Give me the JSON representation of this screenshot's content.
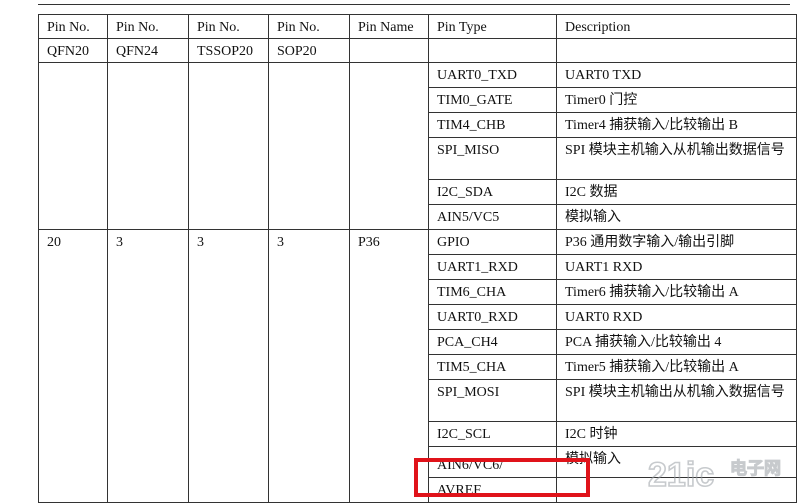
{
  "headers": [
    "Pin No.",
    "Pin No.",
    "Pin No.",
    "Pin No.",
    "Pin Name",
    "Pin Type",
    "Description"
  ],
  "packages": [
    "QFN20",
    "QFN24",
    "TSSOP20",
    "SOP20"
  ],
  "group1": {
    "rows": [
      {
        "type": "UART0_TXD",
        "desc": "UART0 TXD"
      },
      {
        "type": "TIM0_GATE",
        "desc": "Timer0 门控"
      },
      {
        "type": "TIM4_CHB",
        "desc": "Timer4 捕获输入/比较输出 B"
      },
      {
        "type": "SPI_MISO",
        "desc": "SPI 模块主机输入从机输出数据信号"
      },
      {
        "type": "I2C_SDA",
        "desc": "I2C 数据"
      },
      {
        "type": "AIN5/VC5",
        "desc": "模拟输入"
      }
    ]
  },
  "group2": {
    "pin_qfn20": "20",
    "pin_qfn24": "3",
    "pin_tssop20": "3",
    "pin_sop20": "3",
    "pin_name": "P36",
    "rows": [
      {
        "type": "GPIO",
        "desc": "P36 通用数字输入/输出引脚"
      },
      {
        "type": "UART1_RXD",
        "desc": "UART1 RXD"
      },
      {
        "type": "TIM6_CHA",
        "desc": "Timer6 捕获输入/比较输出 A"
      },
      {
        "type": "UART0_RXD",
        "desc": "UART0 RXD"
      },
      {
        "type": "PCA_CH4",
        "desc": "PCA 捕获输入/比较输出 4"
      },
      {
        "type": "TIM5_CHA",
        "desc": "Timer5 捕获输入/比较输出 A"
      },
      {
        "type": "SPI_MOSI",
        "desc": "SPI 模块主机输出从机输入数据信号"
      },
      {
        "type": "I2C_SCL",
        "desc": "I2C 时钟"
      },
      {
        "type": "AIN6/VC6/",
        "desc": "模拟输入"
      },
      {
        "type": "AVREF",
        "desc": ""
      }
    ]
  },
  "watermark": {
    "text": "21ic",
    "sub": "电子网"
  },
  "highlight_color": "#e0131a"
}
